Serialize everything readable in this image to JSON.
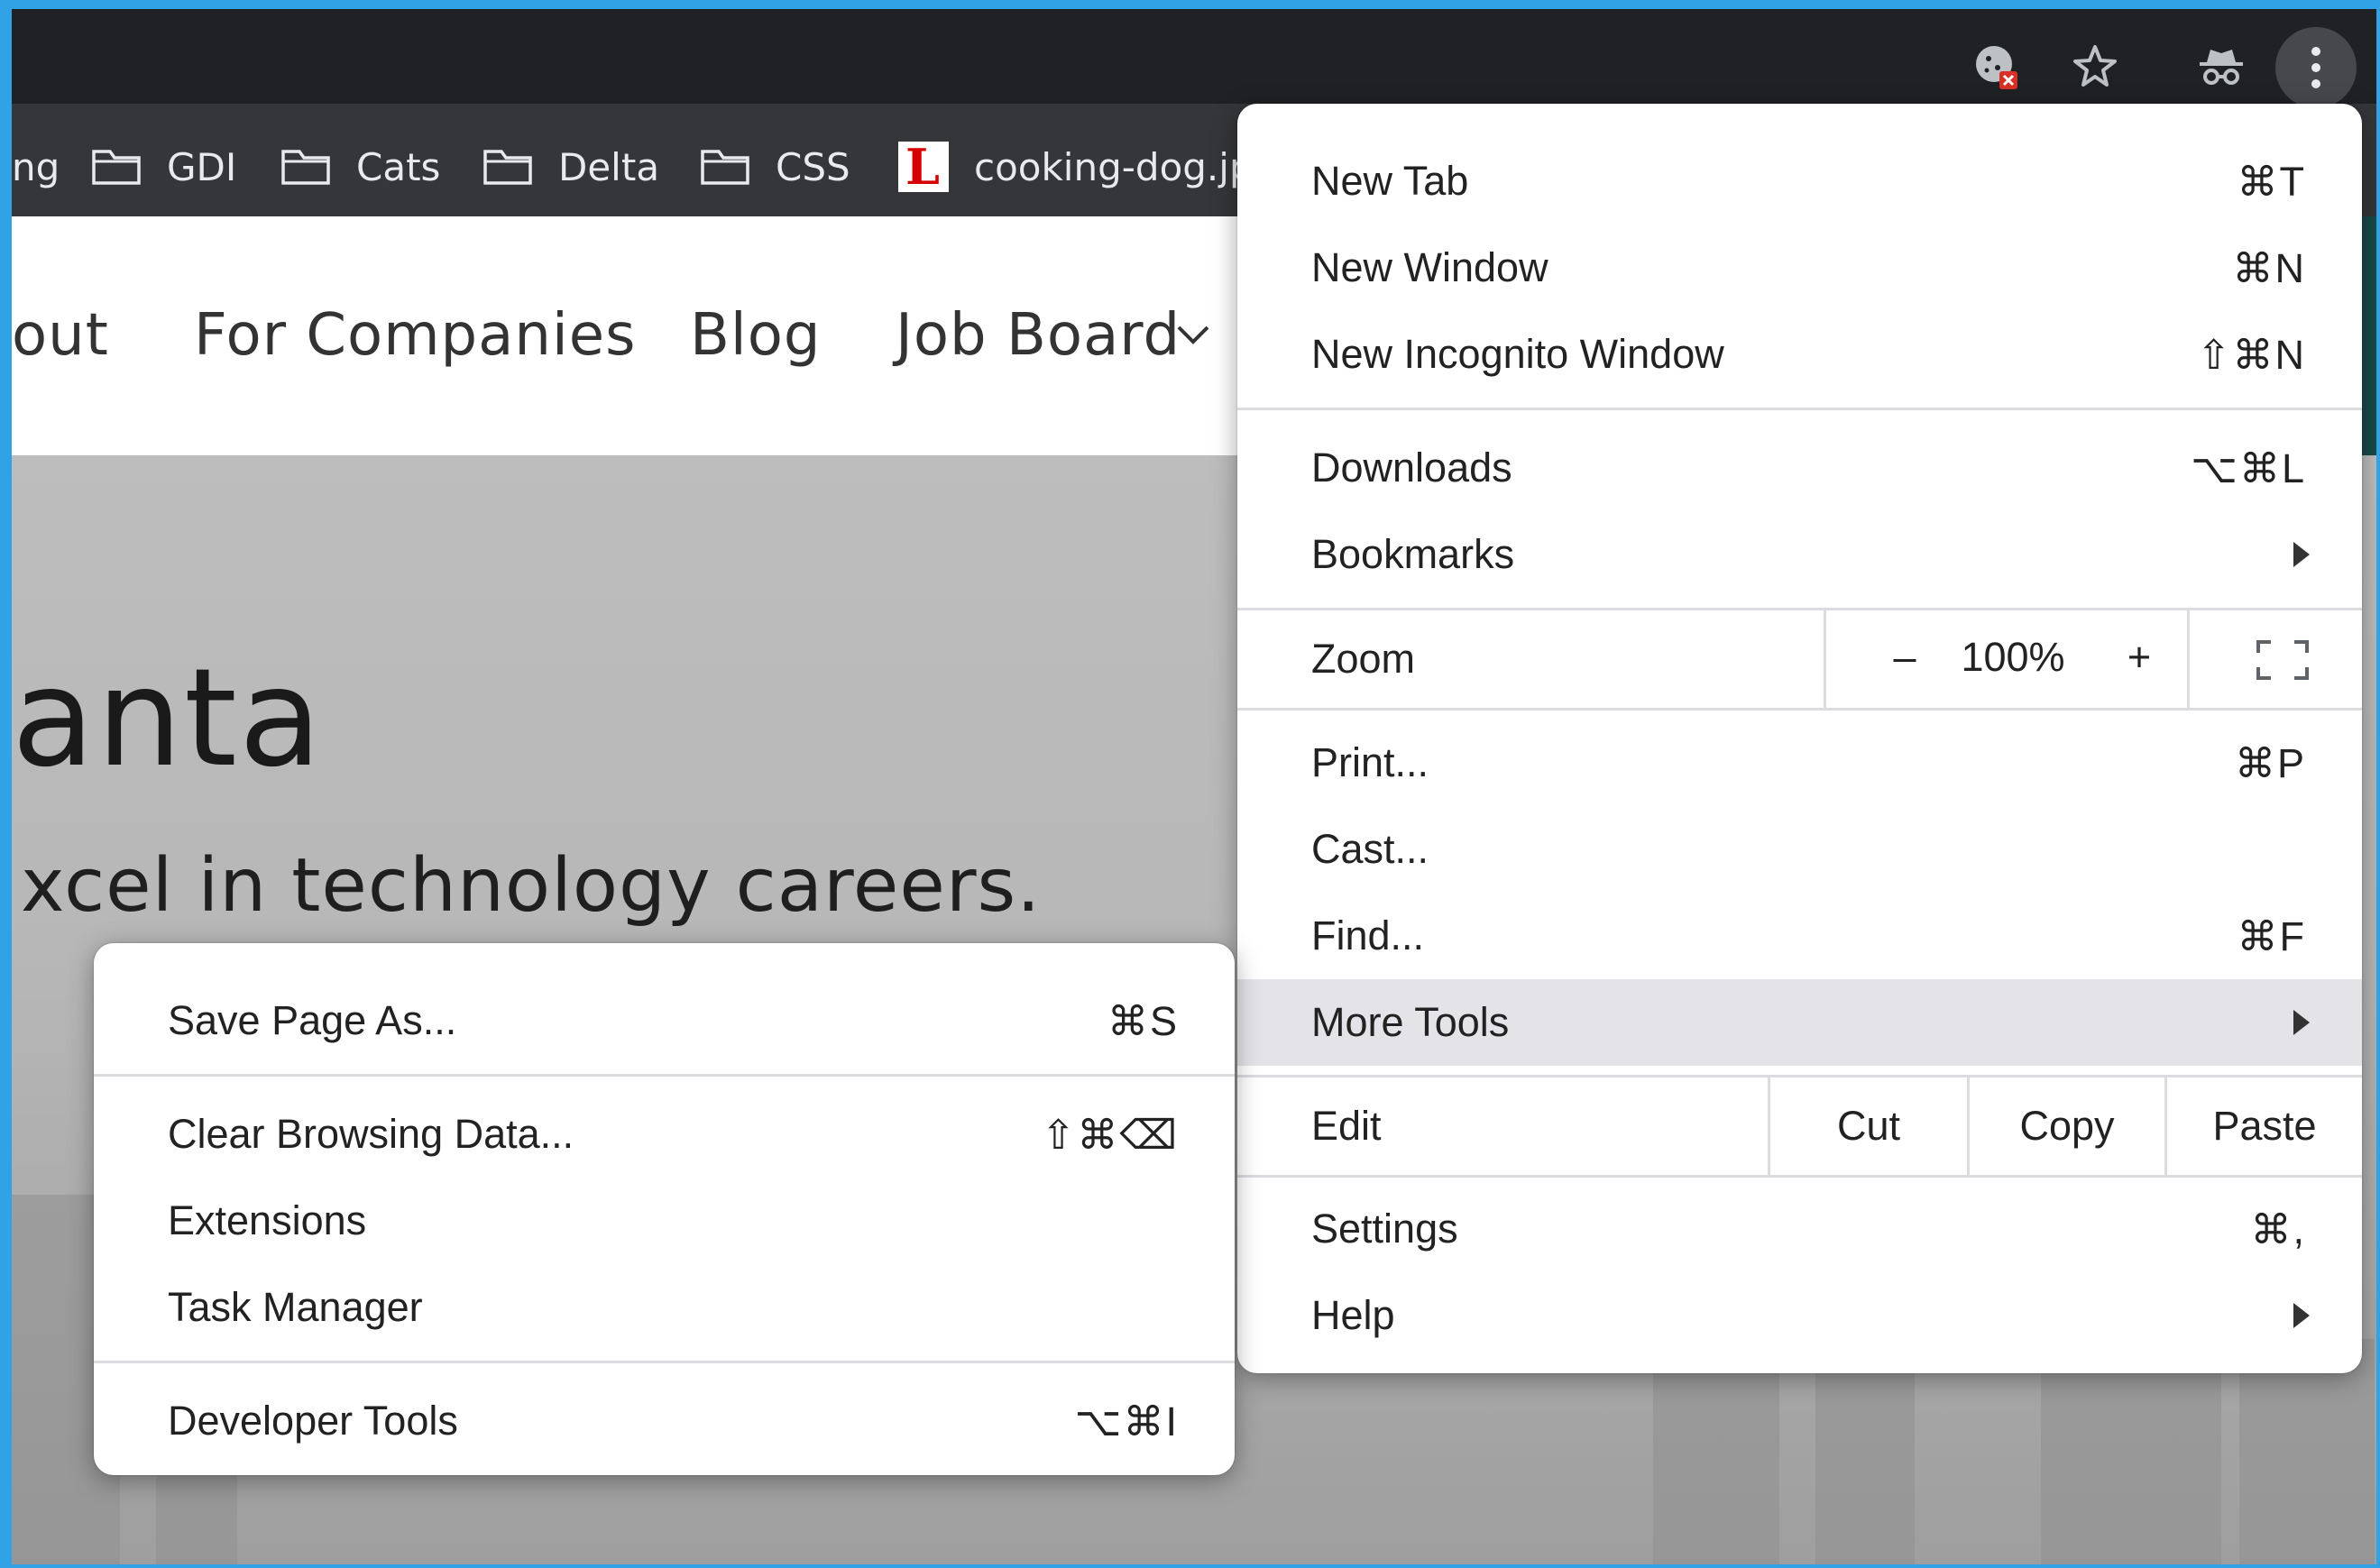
{
  "bookmarks_bar": {
    "items": [
      {
        "label": "ng"
      },
      {
        "label": "GDI"
      },
      {
        "label": "Cats"
      },
      {
        "label": "Delta"
      },
      {
        "label": "CSS"
      },
      {
        "label": "cooking-dog.jp"
      }
    ],
    "favicon_letter": "L"
  },
  "site_nav": {
    "links": [
      "out",
      "For Companies",
      "Blog",
      "Job Board"
    ]
  },
  "hero": {
    "title": "anta",
    "subtitle": "xcel in technology careers."
  },
  "main_menu": {
    "new_tab": {
      "label": "New Tab",
      "shortcut": "⌘T"
    },
    "new_window": {
      "label": "New Window",
      "shortcut": "⌘N"
    },
    "new_incognito": {
      "label": "New Incognito Window",
      "shortcut": "⇧⌘N"
    },
    "downloads": {
      "label": "Downloads",
      "shortcut": "⌥⌘L"
    },
    "bookmarks": {
      "label": "Bookmarks"
    },
    "zoom": {
      "label": "Zoom",
      "minus": "–",
      "value": "100%",
      "plus": "+"
    },
    "print": {
      "label": "Print...",
      "shortcut": "⌘P"
    },
    "cast": {
      "label": "Cast..."
    },
    "find": {
      "label": "Find...",
      "shortcut": "⌘F"
    },
    "more_tools": {
      "label": "More Tools"
    },
    "edit": {
      "label": "Edit",
      "cut": "Cut",
      "copy": "Copy",
      "paste": "Paste"
    },
    "settings": {
      "label": "Settings",
      "shortcut": "⌘,"
    },
    "help": {
      "label": "Help"
    }
  },
  "sub_menu": {
    "save_page": {
      "label": "Save Page As...",
      "shortcut": "⌘S"
    },
    "clear_data": {
      "label": "Clear Browsing Data...",
      "shortcut": "⇧⌘⌫"
    },
    "extensions": {
      "label": "Extensions"
    },
    "task_manager": {
      "label": "Task Manager"
    },
    "dev_tools": {
      "label": "Developer Tools",
      "shortcut": "⌥⌘I"
    }
  },
  "colors": {
    "chrome_dark": "#202124",
    "bookmarks_bar": "#35363a",
    "menu_bg": "#ffffff",
    "highlight": "#e4e4e8",
    "window_border": "#2fa3e6"
  }
}
